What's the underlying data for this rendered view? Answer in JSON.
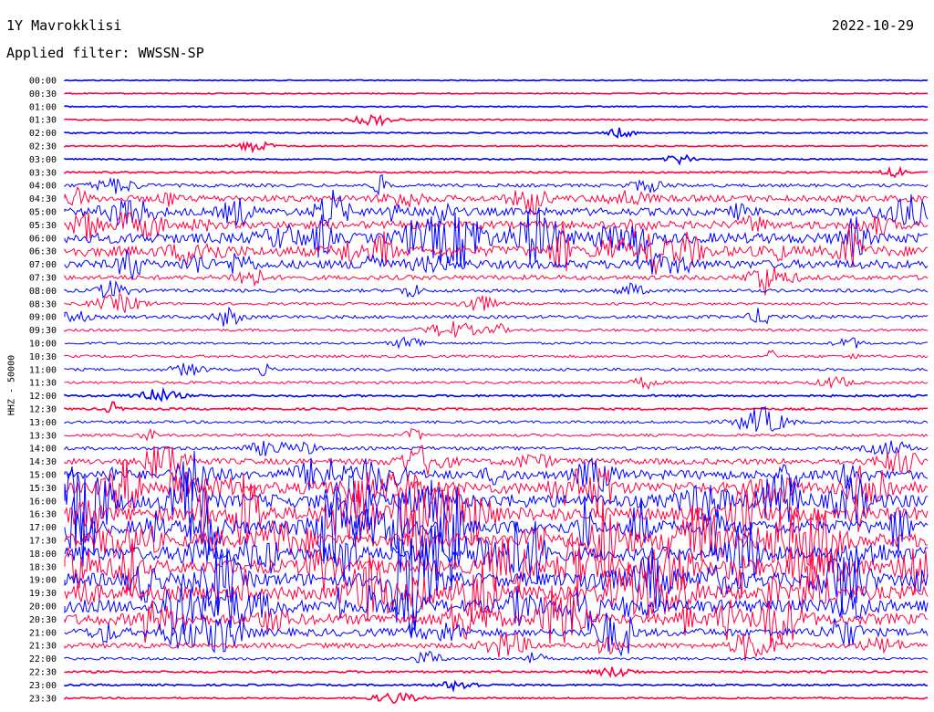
{
  "header": {
    "station": "1Y Mavrokklisi",
    "date": "2022-10-29",
    "filter_label": "Applied filter: WWSSN-SP"
  },
  "chart_data": {
    "type": "line",
    "title": "1Y Mavrokklisi",
    "ylabel": "HHZ - 50000",
    "row_interval_minutes": 30,
    "rows": [
      "00:00",
      "00:30",
      "01:00",
      "01:30",
      "02:00",
      "02:30",
      "03:00",
      "03:30",
      "04:00",
      "04:30",
      "05:00",
      "05:30",
      "06:00",
      "06:30",
      "07:00",
      "07:30",
      "08:00",
      "08:30",
      "09:00",
      "09:30",
      "10:00",
      "10:30",
      "11:00",
      "11:30",
      "12:00",
      "12:30",
      "13:00",
      "13:30",
      "14:00",
      "14:30",
      "15:00",
      "15:30",
      "16:00",
      "16:30",
      "17:00",
      "17:30",
      "18:00",
      "18:30",
      "19:00",
      "19:30",
      "20:00",
      "20:30",
      "21:00",
      "21:30",
      "22:00",
      "22:30",
      "23:00",
      "23:30"
    ],
    "colors": [
      "#0000ff",
      "#ff0040"
    ],
    "activity": [
      0.02,
      0.02,
      0.03,
      0.05,
      0.04,
      0.04,
      0.05,
      0.08,
      0.2,
      0.45,
      0.55,
      0.55,
      0.75,
      0.75,
      0.6,
      0.3,
      0.2,
      0.15,
      0.2,
      0.15,
      0.12,
      0.15,
      0.15,
      0.15,
      0.1,
      0.1,
      0.15,
      0.15,
      0.2,
      0.4,
      0.65,
      0.85,
      1,
      1,
      1,
      1,
      1,
      1,
      1,
      1,
      0.95,
      0.8,
      0.55,
      0.35,
      0.15,
      0.1,
      0.08,
      0.06
    ]
  }
}
